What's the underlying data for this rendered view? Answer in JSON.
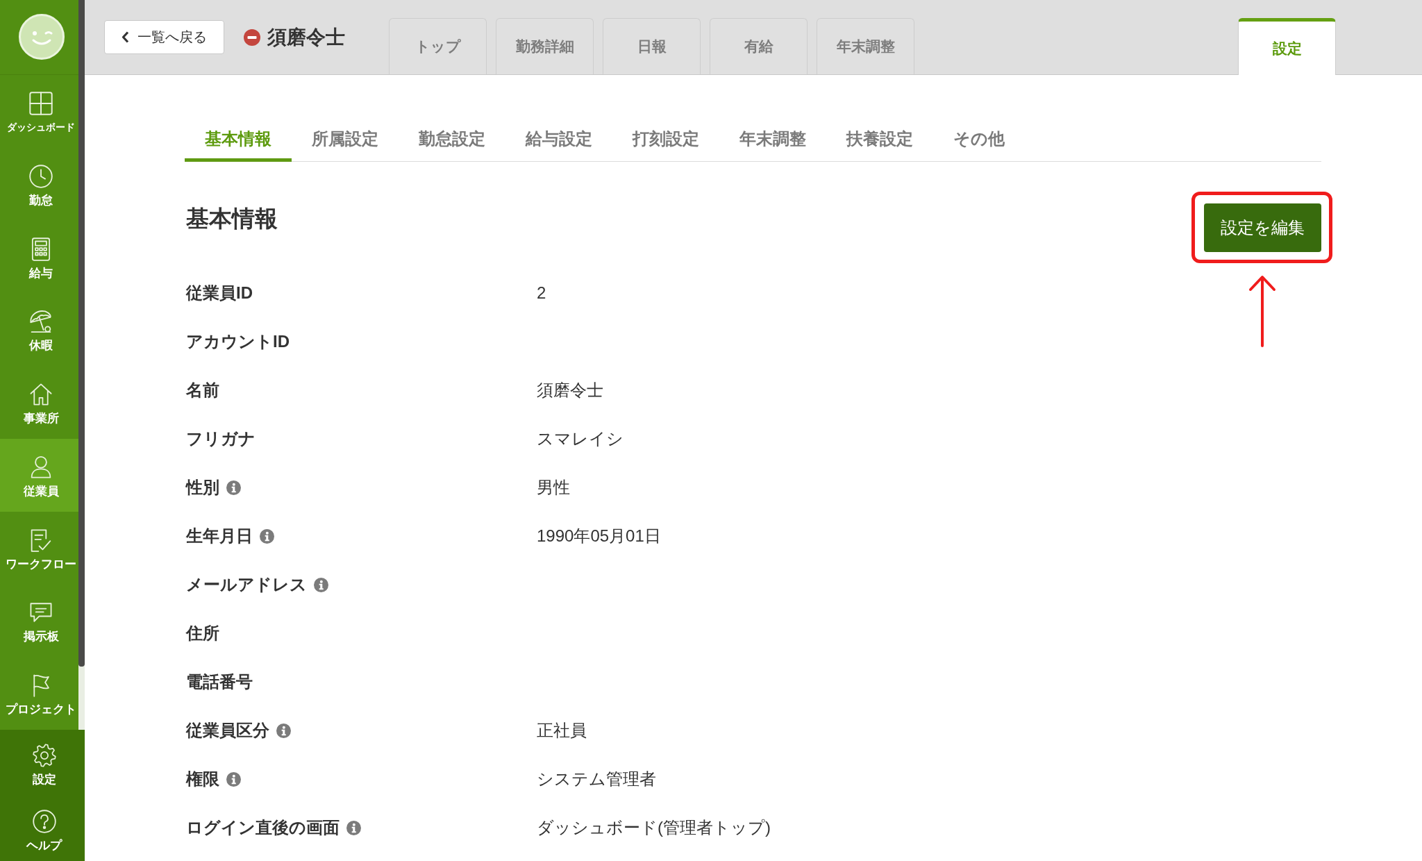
{
  "sidebar": {
    "items": [
      {
        "label": "ダッシュボード",
        "selected": false
      },
      {
        "label": "勤怠",
        "selected": false
      },
      {
        "label": "給与",
        "selected": false
      },
      {
        "label": "休暇",
        "selected": false
      },
      {
        "label": "事業所",
        "selected": false
      },
      {
        "label": "従業員",
        "selected": true
      },
      {
        "label": "ワークフロー",
        "selected": false
      },
      {
        "label": "掲示板",
        "selected": false
      },
      {
        "label": "プロジェクト",
        "selected": false
      }
    ],
    "footer_items": [
      {
        "label": "設定"
      },
      {
        "label": "ヘルプ"
      }
    ]
  },
  "header": {
    "back_button": "一覧へ戻る",
    "employee_name": "須磨令士",
    "tabs": [
      {
        "label": "トップ",
        "selected": false
      },
      {
        "label": "勤務詳細",
        "selected": false
      },
      {
        "label": "日報",
        "selected": false
      },
      {
        "label": "有給",
        "selected": false
      },
      {
        "label": "年末調整",
        "selected": false
      }
    ],
    "right_tabs": [
      {
        "label": "設定",
        "selected": true
      }
    ]
  },
  "settings_tabs": [
    {
      "label": "基本情報",
      "selected": true
    },
    {
      "label": "所属設定",
      "selected": false
    },
    {
      "label": "勤怠設定",
      "selected": false
    },
    {
      "label": "給与設定",
      "selected": false
    },
    {
      "label": "打刻設定",
      "selected": false
    },
    {
      "label": "年末調整",
      "selected": false
    },
    {
      "label": "扶養設定",
      "selected": false
    },
    {
      "label": "その他",
      "selected": false
    }
  ],
  "section": {
    "title": "基本情報",
    "edit_button": {
      "label": "設定を編集",
      "highlighted": true
    },
    "fields": [
      {
        "label": "従業員ID",
        "info": false,
        "value": "2"
      },
      {
        "label": "アカウントID",
        "info": false
      },
      {
        "label": "名前",
        "info": false,
        "value": "須磨令士"
      },
      {
        "label": "フリガナ",
        "info": false,
        "value": "スマレイシ"
      },
      {
        "label": "性別",
        "info": true,
        "value": "男性"
      },
      {
        "label": "生年月日",
        "info": true,
        "value": "1990年05月01日"
      },
      {
        "label": "メールアドレス",
        "info": true
      },
      {
        "label": "住所",
        "info": false
      },
      {
        "label": "電話番号",
        "info": false
      },
      {
        "label": "従業員区分",
        "info": true,
        "value": "正社員"
      },
      {
        "label": "権限",
        "info": true,
        "value": "システム管理者"
      },
      {
        "label": "ログイン直後の画面",
        "info": true,
        "value": "ダッシュボード(管理者トップ)"
      }
    ]
  }
}
